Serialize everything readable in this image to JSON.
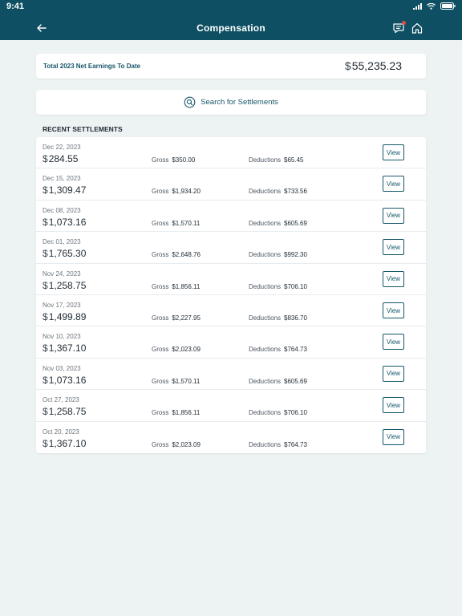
{
  "status_bar": {
    "time": "9:41"
  },
  "header": {
    "title": "Compensation"
  },
  "summary": {
    "label": "Total 2023 Net Earnings To Date",
    "currency": "$",
    "value": "55,235.23"
  },
  "search": {
    "label": "Search for Settlements"
  },
  "section": {
    "title": "RECENT SETTLEMENTS"
  },
  "labels": {
    "gross": "Gross",
    "deductions": "Deductions",
    "view": "View",
    "currency": "$"
  },
  "settlements": [
    {
      "date": "Dec 22, 2023",
      "net": "284.55",
      "gross": "$350.00",
      "deductions": "$65.45"
    },
    {
      "date": "Dec 15, 2023",
      "net": "1,309.47",
      "gross": "$1,934.20",
      "deductions": "$733.56"
    },
    {
      "date": "Dec 08, 2023",
      "net": "1,073.16",
      "gross": "$1,570.11",
      "deductions": "$605.69"
    },
    {
      "date": "Dec 01, 2023",
      "net": "1,765.30",
      "gross": "$2,648.76",
      "deductions": "$992.30"
    },
    {
      "date": "Nov 24, 2023",
      "net": "1,258.75",
      "gross": "$1,856.11",
      "deductions": "$706.10"
    },
    {
      "date": "Nov 17, 2023",
      "net": "1,499.89",
      "gross": "$2,227.95",
      "deductions": "$836.70"
    },
    {
      "date": "Nov 10, 2023",
      "net": "1,367.10",
      "gross": "$2,023.09",
      "deductions": "$764.73"
    },
    {
      "date": "Nov 03, 2023",
      "net": "1,073.16",
      "gross": "$1,570.11",
      "deductions": "$605.69"
    },
    {
      "date": "Oct 27, 2023",
      "net": "1,258.75",
      "gross": "$1,856.11",
      "deductions": "$706.10"
    },
    {
      "date": "Oct 20, 2023",
      "net": "1,367.10",
      "gross": "$2,023.09",
      "deductions": "$764.73"
    }
  ],
  "colors": {
    "header_bg": "#0e4f63",
    "accent": "#16566b",
    "notification": "#e04b4b",
    "page_bg": "#edf2f3"
  }
}
